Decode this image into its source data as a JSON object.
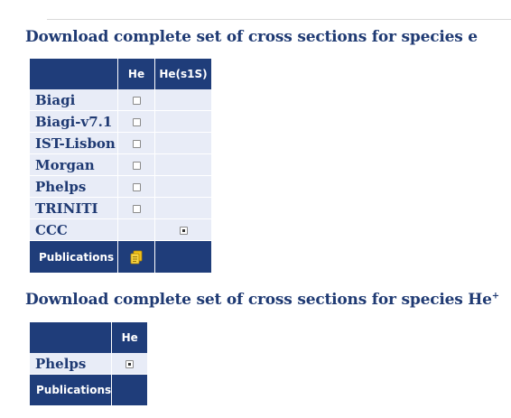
{
  "section1": {
    "title": "Download complete set of cross sections for species e",
    "columns": [
      "He",
      "He(s1S)"
    ],
    "rows": [
      {
        "name": "Biagi",
        "checks": [
          "unchecked",
          null
        ]
      },
      {
        "name": "Biagi-v7.1",
        "checks": [
          "unchecked",
          null
        ]
      },
      {
        "name": "IST-Lisbon",
        "checks": [
          "unchecked",
          null
        ]
      },
      {
        "name": "Morgan",
        "checks": [
          "unchecked",
          null
        ]
      },
      {
        "name": "Phelps",
        "checks": [
          "unchecked",
          null
        ]
      },
      {
        "name": "TRINITI",
        "checks": [
          "unchecked",
          null
        ]
      },
      {
        "name": "CCC",
        "checks": [
          null,
          "checked"
        ]
      }
    ],
    "footer_label": "Publications",
    "footer_icon": "documents-icon"
  },
  "section2": {
    "title": "Download complete set of cross sections for species He",
    "title_sup": "+",
    "columns": [
      "He"
    ],
    "rows": [
      {
        "name": "Phelps",
        "checks": [
          "checked"
        ]
      }
    ],
    "footer_label": "Publications"
  },
  "colors": {
    "header_bg": "#1f3d7a",
    "row_bg": "#e8ecf7",
    "title_text": "#1f3a73",
    "icon_yellow": "#f2c21b"
  }
}
